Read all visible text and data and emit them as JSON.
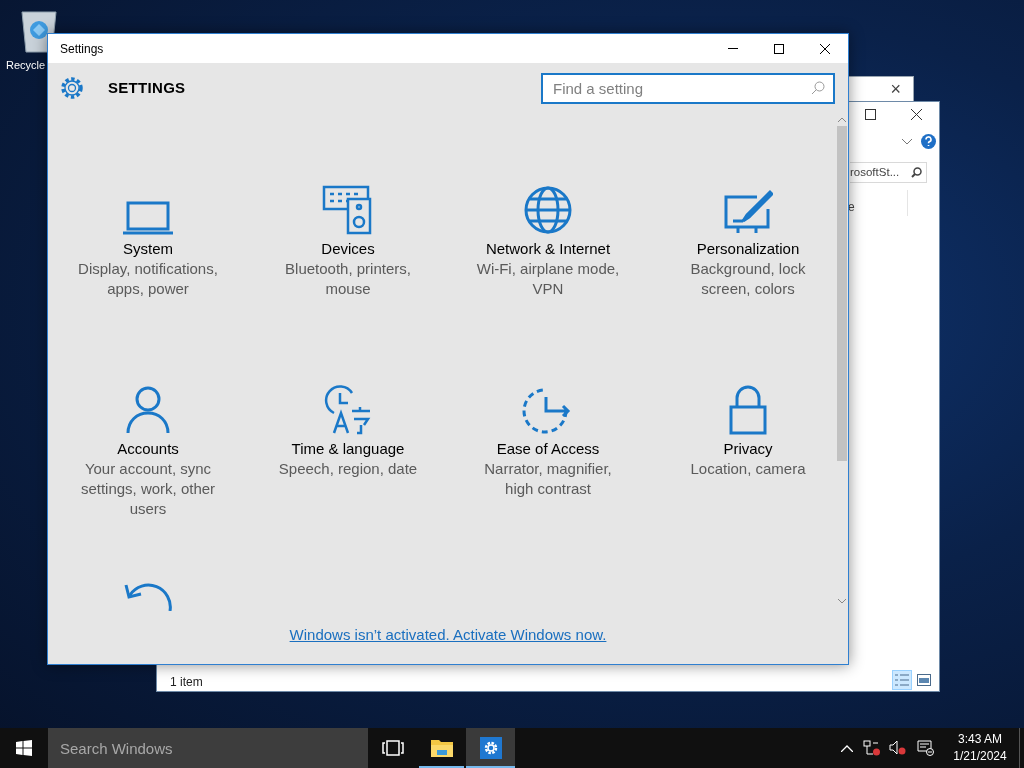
{
  "desktop": {
    "icons": [
      {
        "label": "Recycle"
      }
    ]
  },
  "back_window": {
    "close": "×"
  },
  "explorer": {
    "search_value": "rosoftSt...",
    "column_fragment": "e",
    "status": "1 item",
    "views": [
      {
        "kind": "details",
        "selected": true
      },
      {
        "kind": "preview",
        "selected": false
      }
    ]
  },
  "settings": {
    "title": "Settings",
    "header": "SETTINGS",
    "search": {
      "placeholder": "Find a setting"
    },
    "categories": [
      {
        "kind": "system",
        "title": "System",
        "description": "Display, notifications, apps, power"
      },
      {
        "kind": "devices",
        "title": "Devices",
        "description": "Bluetooth, printers, mouse"
      },
      {
        "kind": "network",
        "title": "Network & Internet",
        "description": "Wi-Fi, airplane mode, VPN"
      },
      {
        "kind": "personalization",
        "title": "Personalization",
        "description": "Background, lock screen, colors"
      },
      {
        "kind": "accounts",
        "title": "Accounts",
        "description": "Your account, sync settings, work, other users"
      },
      {
        "kind": "time",
        "title": "Time & language",
        "description": "Speech, region, date"
      },
      {
        "kind": "ease",
        "title": "Ease of Access",
        "description": "Narrator, magnifier, high contrast"
      },
      {
        "kind": "privacy",
        "title": "Privacy",
        "description": "Location, camera"
      },
      {
        "kind": "update"
      }
    ],
    "activation_link": "Windows isn’t activated. Activate Windows now."
  },
  "taskbar": {
    "search": {
      "placeholder": "Search Windows"
    },
    "apps": [
      {
        "kind": "taskview",
        "selected": false,
        "running": false
      },
      {
        "kind": "explorer",
        "selected": false,
        "running": true
      },
      {
        "kind": "settings",
        "selected": true,
        "running": true
      }
    ],
    "time": "3:43 AM",
    "date": "1/21/2024"
  }
}
